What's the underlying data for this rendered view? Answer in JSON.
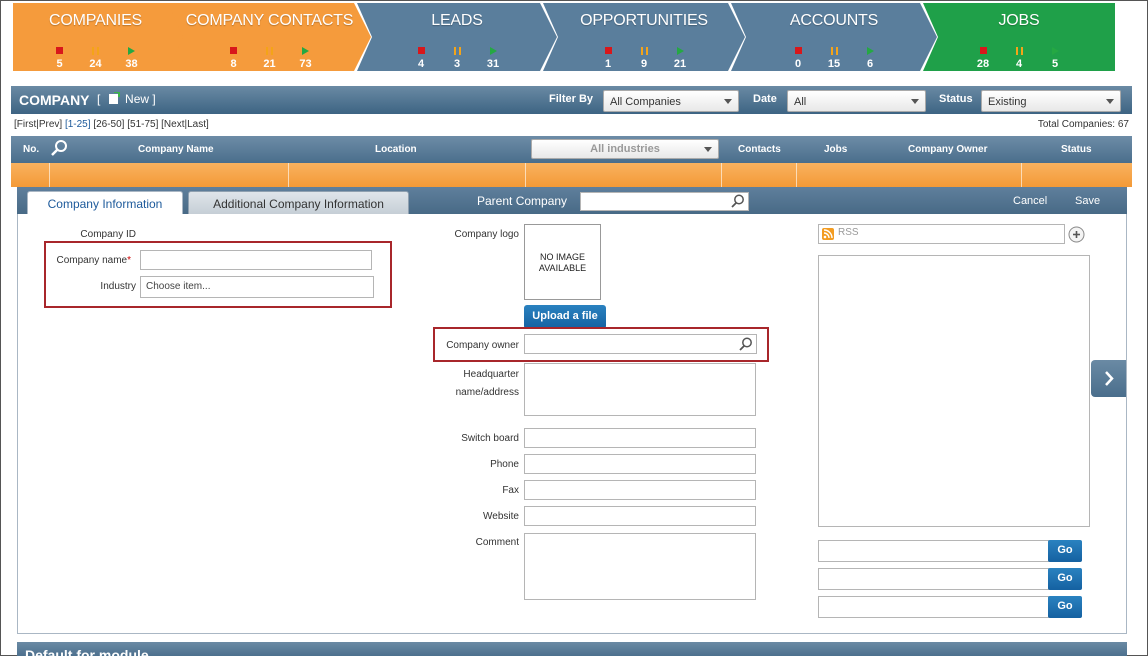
{
  "pipeline": [
    {
      "title": "COMPANIES",
      "stopped": "5",
      "paused": "24",
      "active": "38",
      "color": "#f59b3c"
    },
    {
      "title": "COMPANY CONTACTS",
      "stopped": "8",
      "paused": "21",
      "active": "73",
      "color": "#f59b3c"
    },
    {
      "title": "LEADS",
      "stopped": "4",
      "paused": "3",
      "active": "31",
      "color": "#5a7e9c"
    },
    {
      "title": "OPPORTUNITIES",
      "stopped": "1",
      "paused": "9",
      "active": "21",
      "color": "#5a7e9c"
    },
    {
      "title": "ACCOUNTS",
      "stopped": "0",
      "paused": "15",
      "active": "6",
      "color": "#5a7e9c"
    },
    {
      "title": "JOBS",
      "stopped": "28",
      "paused": "4",
      "active": "5",
      "color": "#1fa049"
    }
  ],
  "header": {
    "title": "COMPANY",
    "new_bracket_open": "[",
    "new_label": "New",
    "new_bracket_close": "]",
    "filter_label": "Filter By",
    "filter_value": "All Companies",
    "date_label": "Date",
    "date_value": "All",
    "status_label": "Status",
    "status_value": "Existing"
  },
  "pager": {
    "first": "[First",
    "sep1": "|",
    "prev": "Prev]",
    "p1": "[1-25]",
    "p2": "[26-50]",
    "p3": "[51-75]",
    "next": "[Next",
    "sep2": "|",
    "last": "Last]",
    "total": "Total Companies: 67"
  },
  "grid": {
    "col_no": "No.",
    "col_name": "Company Name",
    "col_location": "Location",
    "industry_filter": "All industries",
    "col_contacts": "Contacts",
    "col_jobs": "Jobs",
    "col_owner": "Company Owner",
    "col_status": "Status"
  },
  "tabs": {
    "tab1": "Company Information",
    "tab2": "Additional Company Information",
    "parent_label": "Parent Company",
    "cancel": "Cancel",
    "save": "Save"
  },
  "form": {
    "company_id_label": "Company ID",
    "company_name_label": "Company name",
    "required_mark": "*",
    "industry_label": "Industry",
    "industry_placeholder": "Choose item...",
    "logo_label": "Company logo",
    "no_image": "NO IMAGE AVAILABLE",
    "upload": "Upload a file",
    "owner_label": "Company owner",
    "hq_label": "Headquarter name/address",
    "switch_label": "Switch board",
    "phone_label": "Phone",
    "fax_label": "Fax",
    "website_label": "Website",
    "comment_label": "Comment"
  },
  "rss": {
    "label": "RSS",
    "go1": "Go",
    "go2": "Go",
    "go3": "Go"
  },
  "bottom": {
    "title": "Default for module"
  }
}
